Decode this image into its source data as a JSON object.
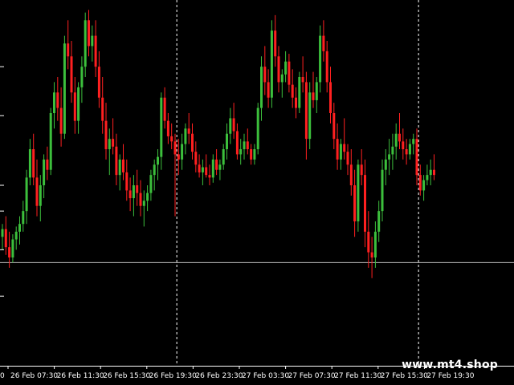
{
  "watermark": "www.mt4.shop",
  "chart_data": {
    "type": "candlestick",
    "title": "",
    "xlabel": "",
    "ylabel": "",
    "grid": false,
    "colors": {
      "background": "#000000",
      "bull": "#3cbf3c",
      "bear": "#ff2020",
      "axis": "#ffffff",
      "level_line": "#bdbdbd",
      "separator": "#ffffff"
    },
    "first_tick_label": "0",
    "x_ticks": [
      "26 Feb 07:30",
      "26 Feb 11:30",
      "26 Feb 15:30",
      "26 Feb 19:30",
      "26 Feb 23:30",
      "27 Feb 03:30",
      "27 Feb 07:30",
      "27 Feb 11:30",
      "27 Feb 15:30",
      "27 Feb 19:30"
    ],
    "y_ticks": [
      0.76,
      0.57,
      0.3,
      0.2,
      0.05,
      -0.13
    ],
    "ylim": [
      -0.4,
      1.0
    ],
    "horizontal_level": 0.0,
    "session_separators": [
      50.5,
      120.5
    ],
    "candles": [
      [
        0.1,
        0.15,
        0.05,
        0.13
      ],
      [
        0.13,
        0.18,
        0.03,
        0.06
      ],
      [
        0.06,
        0.12,
        -0.02,
        0.02
      ],
      [
        0.02,
        0.11,
        0.0,
        0.09
      ],
      [
        0.09,
        0.14,
        0.05,
        0.12
      ],
      [
        0.12,
        0.18,
        0.07,
        0.15
      ],
      [
        0.15,
        0.24,
        0.12,
        0.2
      ],
      [
        0.2,
        0.36,
        0.15,
        0.33
      ],
      [
        0.33,
        0.48,
        0.3,
        0.44
      ],
      [
        0.44,
        0.5,
        0.3,
        0.33
      ],
      [
        0.33,
        0.4,
        0.18,
        0.22
      ],
      [
        0.22,
        0.34,
        0.16,
        0.3
      ],
      [
        0.3,
        0.42,
        0.25,
        0.4
      ],
      [
        0.4,
        0.45,
        0.32,
        0.36
      ],
      [
        0.36,
        0.6,
        0.34,
        0.58
      ],
      [
        0.58,
        0.7,
        0.52,
        0.66
      ],
      [
        0.66,
        0.72,
        0.55,
        0.6
      ],
      [
        0.6,
        0.68,
        0.45,
        0.5
      ],
      [
        0.5,
        0.88,
        0.48,
        0.85
      ],
      [
        0.85,
        0.94,
        0.75,
        0.8
      ],
      [
        0.8,
        0.86,
        0.62,
        0.66
      ],
      [
        0.66,
        0.72,
        0.5,
        0.55
      ],
      [
        0.55,
        0.7,
        0.5,
        0.68
      ],
      [
        0.68,
        0.8,
        0.62,
        0.76
      ],
      [
        0.76,
        0.97,
        0.72,
        0.94
      ],
      [
        0.94,
        0.98,
        0.8,
        0.84
      ],
      [
        0.84,
        0.92,
        0.78,
        0.88
      ],
      [
        0.88,
        0.94,
        0.72,
        0.76
      ],
      [
        0.76,
        0.82,
        0.6,
        0.64
      ],
      [
        0.64,
        0.72,
        0.5,
        0.55
      ],
      [
        0.55,
        0.62,
        0.4,
        0.44
      ],
      [
        0.44,
        0.52,
        0.34,
        0.48
      ],
      [
        0.48,
        0.56,
        0.42,
        0.45
      ],
      [
        0.45,
        0.5,
        0.3,
        0.34
      ],
      [
        0.34,
        0.42,
        0.28,
        0.4
      ],
      [
        0.4,
        0.46,
        0.32,
        0.35
      ],
      [
        0.35,
        0.4,
        0.24,
        0.28
      ],
      [
        0.28,
        0.33,
        0.2,
        0.25
      ],
      [
        0.25,
        0.34,
        0.18,
        0.3
      ],
      [
        0.3,
        0.36,
        0.22,
        0.27
      ],
      [
        0.27,
        0.32,
        0.18,
        0.22
      ],
      [
        0.22,
        0.28,
        0.14,
        0.24
      ],
      [
        0.24,
        0.3,
        0.2,
        0.27
      ],
      [
        0.27,
        0.36,
        0.24,
        0.34
      ],
      [
        0.34,
        0.4,
        0.28,
        0.38
      ],
      [
        0.38,
        0.44,
        0.32,
        0.41
      ],
      [
        0.41,
        0.66,
        0.36,
        0.64
      ],
      [
        0.64,
        0.68,
        0.52,
        0.55
      ],
      [
        0.55,
        0.58,
        0.46,
        0.49
      ],
      [
        0.49,
        0.54,
        0.44,
        0.47
      ],
      [
        0.47,
        0.5,
        0.18,
        0.42
      ],
      [
        0.42,
        0.48,
        0.34,
        0.4
      ],
      [
        0.4,
        0.5,
        0.36,
        0.46
      ],
      [
        0.46,
        0.54,
        0.42,
        0.52
      ],
      [
        0.52,
        0.58,
        0.46,
        0.5
      ],
      [
        0.5,
        0.54,
        0.4,
        0.43
      ],
      [
        0.43,
        0.47,
        0.35,
        0.38
      ],
      [
        0.38,
        0.42,
        0.33,
        0.35
      ],
      [
        0.35,
        0.4,
        0.3,
        0.37
      ],
      [
        0.37,
        0.42,
        0.33,
        0.34
      ],
      [
        0.34,
        0.38,
        0.3,
        0.33
      ],
      [
        0.33,
        0.42,
        0.31,
        0.4
      ],
      [
        0.4,
        0.44,
        0.34,
        0.36
      ],
      [
        0.36,
        0.4,
        0.32,
        0.38
      ],
      [
        0.38,
        0.46,
        0.36,
        0.44
      ],
      [
        0.44,
        0.54,
        0.4,
        0.5
      ],
      [
        0.5,
        0.6,
        0.46,
        0.56
      ],
      [
        0.56,
        0.62,
        0.48,
        0.51
      ],
      [
        0.51,
        0.54,
        0.4,
        0.42
      ],
      [
        0.42,
        0.48,
        0.38,
        0.44
      ],
      [
        0.44,
        0.5,
        0.4,
        0.47
      ],
      [
        0.47,
        0.52,
        0.42,
        0.44
      ],
      [
        0.44,
        0.46,
        0.38,
        0.4
      ],
      [
        0.4,
        0.46,
        0.38,
        0.44
      ],
      [
        0.44,
        0.62,
        0.42,
        0.6
      ],
      [
        0.6,
        0.8,
        0.55,
        0.76
      ],
      [
        0.76,
        0.84,
        0.65,
        0.7
      ],
      [
        0.7,
        0.75,
        0.6,
        0.64
      ],
      [
        0.64,
        0.94,
        0.6,
        0.9
      ],
      [
        0.9,
        0.96,
        0.76,
        0.8
      ],
      [
        0.8,
        0.84,
        0.66,
        0.7
      ],
      [
        0.7,
        0.75,
        0.64,
        0.73
      ],
      [
        0.73,
        0.82,
        0.7,
        0.78
      ],
      [
        0.78,
        0.81,
        0.66,
        0.69
      ],
      [
        0.69,
        0.75,
        0.6,
        0.64
      ],
      [
        0.64,
        0.68,
        0.56,
        0.6
      ],
      [
        0.6,
        0.74,
        0.58,
        0.72
      ],
      [
        0.72,
        0.8,
        0.66,
        0.7
      ],
      [
        0.7,
        0.74,
        0.4,
        0.48
      ],
      [
        0.48,
        0.7,
        0.44,
        0.66
      ],
      [
        0.66,
        0.74,
        0.6,
        0.63
      ],
      [
        0.63,
        0.72,
        0.58,
        0.7
      ],
      [
        0.7,
        0.92,
        0.66,
        0.88
      ],
      [
        0.88,
        0.94,
        0.78,
        0.82
      ],
      [
        0.82,
        0.86,
        0.66,
        0.7
      ],
      [
        0.7,
        0.76,
        0.54,
        0.58
      ],
      [
        0.58,
        0.62,
        0.44,
        0.48
      ],
      [
        0.48,
        0.54,
        0.36,
        0.4
      ],
      [
        0.4,
        0.48,
        0.36,
        0.46
      ],
      [
        0.46,
        0.56,
        0.4,
        0.43
      ],
      [
        0.43,
        0.46,
        0.34,
        0.38
      ],
      [
        0.38,
        0.44,
        0.26,
        0.3
      ],
      [
        0.3,
        0.36,
        0.1,
        0.16
      ],
      [
        0.16,
        0.4,
        0.12,
        0.38
      ],
      [
        0.38,
        0.44,
        0.3,
        0.34
      ],
      [
        0.34,
        0.4,
        0.06,
        0.12
      ],
      [
        0.12,
        0.2,
        -0.02,
        0.04
      ],
      [
        0.04,
        0.1,
        -0.06,
        0.02
      ],
      [
        0.02,
        0.16,
        -0.02,
        0.12
      ],
      [
        0.12,
        0.24,
        0.08,
        0.2
      ],
      [
        0.2,
        0.4,
        0.16,
        0.36
      ],
      [
        0.36,
        0.44,
        0.3,
        0.4
      ],
      [
        0.4,
        0.48,
        0.34,
        0.42
      ],
      [
        0.42,
        0.5,
        0.36,
        0.45
      ],
      [
        0.45,
        0.54,
        0.4,
        0.5
      ],
      [
        0.5,
        0.58,
        0.44,
        0.47
      ],
      [
        0.47,
        0.52,
        0.4,
        0.44
      ],
      [
        0.44,
        0.48,
        0.38,
        0.42
      ],
      [
        0.42,
        0.48,
        0.4,
        0.46
      ],
      [
        0.46,
        0.5,
        0.42,
        0.48
      ],
      [
        0.48,
        0.52,
        0.3,
        0.34
      ],
      [
        0.34,
        0.38,
        0.26,
        0.28
      ],
      [
        0.28,
        0.34,
        0.24,
        0.32
      ],
      [
        0.32,
        0.38,
        0.3,
        0.34
      ],
      [
        0.34,
        0.4,
        0.3,
        0.36
      ],
      [
        0.36,
        0.42,
        0.32,
        0.34
      ]
    ]
  }
}
